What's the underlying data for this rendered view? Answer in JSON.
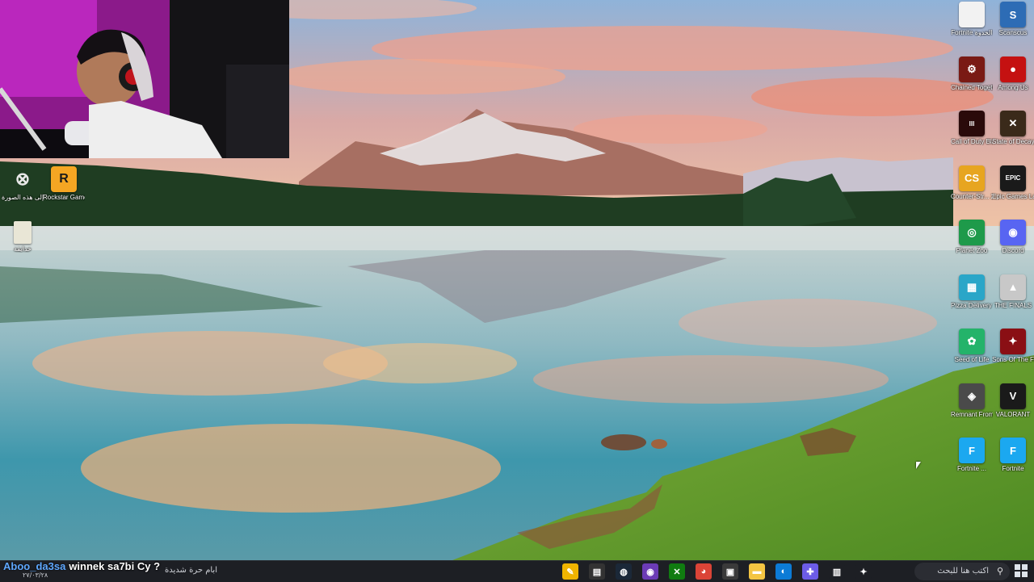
{
  "desktop": {
    "left_icons": [
      {
        "name": "learn-about-picture",
        "label": "تعرف إلى هذه الصورة",
        "glyph": "⊗",
        "color": "#3a3f47"
      },
      {
        "name": "rockstar-games",
        "label": "Rockstar Games ...",
        "glyph": "R",
        "color": "#f5a623"
      },
      {
        "name": "folder-file",
        "label": "خدايقة",
        "glyph": "",
        "color": "#e9e6d6"
      }
    ],
    "right_icons": [
      {
        "name": "fortnite-file",
        "label": "Fortnite الخدوة",
        "glyph": "",
        "color": "#f2f2f2"
      },
      {
        "name": "scanner",
        "label": "Scanscus",
        "glyph": "S",
        "color": "#2d6cb5"
      },
      {
        "name": "chained-together",
        "label": "Chained Togethe",
        "glyph": "⚙",
        "color": "#7a1a14"
      },
      {
        "name": "among-us",
        "label": "Among Us",
        "glyph": "●",
        "color": "#c51111"
      },
      {
        "name": "call-of-duty",
        "label": "Call of Duty Black Ops",
        "glyph": "III",
        "color": "#2a0a0a"
      },
      {
        "name": "state-of-decay",
        "label": "State of Decay",
        "glyph": "✕",
        "color": "#3a2a1a"
      },
      {
        "name": "counter-strike-2",
        "label": "Counter-Str... 2",
        "glyph": "CS",
        "color": "#e7a520"
      },
      {
        "name": "epic-games-launcher",
        "label": "Epic Games Launcher",
        "glyph": "EPIC",
        "color": "#1a1a1a"
      },
      {
        "name": "planet-zoo",
        "label": "Planet Zoo",
        "glyph": "◎",
        "color": "#1e9a4a"
      },
      {
        "name": "discord",
        "label": "Discord",
        "glyph": "◉",
        "color": "#5865f2"
      },
      {
        "name": "pizza-delivery",
        "label": "Pizza Delivery Simulator",
        "glyph": "▦",
        "color": "#2aa6c8"
      },
      {
        "name": "the-finals",
        "label": "THE FINALS",
        "glyph": "▲",
        "color": "#c8c8c8"
      },
      {
        "name": "seed-of-life",
        "label": "Seed of Life",
        "glyph": "✿",
        "color": "#24b36a"
      },
      {
        "name": "sons-of-the-forest",
        "label": "Sons Of The Forest",
        "glyph": "✦",
        "color": "#8a0f14"
      },
      {
        "name": "remnant-from-the-ashes",
        "label": "Remnant From t...",
        "glyph": "◈",
        "color": "#4a4a4a"
      },
      {
        "name": "valorant",
        "label": "VALORANT",
        "glyph": "V",
        "color": "#1a1a1a"
      },
      {
        "name": "fortnite-1",
        "label": "Fortnite ...",
        "glyph": "F",
        "color": "#1ba8f0"
      },
      {
        "name": "fortnite-2",
        "label": "Fortnite",
        "glyph": "F",
        "color": "#1ba8f0"
      }
    ]
  },
  "chat_overlay": {
    "username": "Aboo_da3sa",
    "message": "winnek sa7bi Cy ?"
  },
  "taskbar": {
    "search_placeholder": "اكتب هنا للبحث",
    "search_icon": "search-icon",
    "tray_text": "ابام حرة شديدة",
    "date": "٢٧/٠٣/٢٨",
    "pinned": [
      {
        "name": "pin-app-1",
        "glyph": "✎",
        "color": "#f0b400"
      },
      {
        "name": "pin-terminal",
        "glyph": "▤",
        "color": "#333"
      },
      {
        "name": "pin-steam",
        "glyph": "◍",
        "color": "#1b2838"
      },
      {
        "name": "pin-discord-ptb",
        "glyph": "◉",
        "color": "#6b3bb5"
      },
      {
        "name": "pin-xbox",
        "glyph": "✕",
        "color": "#107c10"
      },
      {
        "name": "pin-chrome",
        "glyph": "◕",
        "color": "#db4437"
      },
      {
        "name": "pin-store",
        "glyph": "▣",
        "color": "#3a3a3a"
      },
      {
        "name": "pin-explorer",
        "glyph": "▬",
        "color": "#f4c542"
      },
      {
        "name": "pin-edge",
        "glyph": "◐",
        "color": "#0c7bd6"
      },
      {
        "name": "pin-copilot",
        "glyph": "✚",
        "color": "#6c5ce7"
      },
      {
        "name": "pin-task-view",
        "glyph": "▥",
        "color": "#1d1f24"
      },
      {
        "name": "pin-widgets",
        "glyph": "✦",
        "color": "#1d1f24"
      }
    ]
  }
}
